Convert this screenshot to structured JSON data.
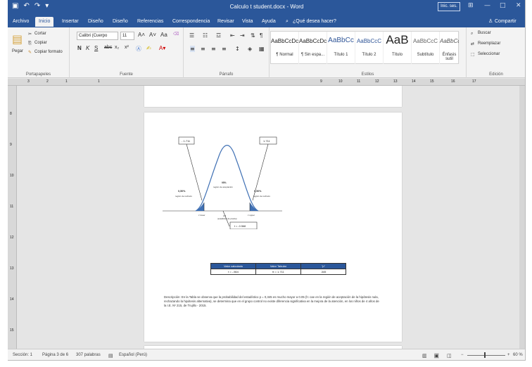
{
  "app": {
    "title": "Calculo t student.docx  -  Word",
    "signin": "Inic. ses.",
    "controls": [
      "⊞",
      "—",
      "□",
      "✕"
    ]
  },
  "quick_access": {
    "save_icon": "save-icon",
    "undo_icon": "undo-icon",
    "redo_icon": "redo-icon"
  },
  "tabs": [
    "Archivo",
    "Inicio",
    "Insertar",
    "Diseño",
    "Diseño",
    "Referencias",
    "Correspondencia",
    "Revisar",
    "Vista",
    "Ayuda"
  ],
  "tell_me": "¿Qué desea hacer?",
  "share": "Compartir",
  "clipboard": {
    "paste": "Pegar",
    "cut": "Cortar",
    "copy": "Copiar",
    "format": "Copiar formato",
    "label": "Portapapeles"
  },
  "font": {
    "family": "Calibri (Cuerpo",
    "size": "11",
    "label": "Fuente"
  },
  "paragraph": {
    "label": "Párrafo"
  },
  "styles": {
    "label": "Estilos",
    "items": [
      {
        "sample": "AaBbCcDc",
        "name": "¶ Normal"
      },
      {
        "sample": "AaBbCcDc",
        "name": "¶ Sin espa..."
      },
      {
        "sample": "AaBbCc",
        "name": "Título 1"
      },
      {
        "sample": "AaBbCcC",
        "name": "Título 2"
      },
      {
        "sample": "AaB",
        "name": "Título"
      },
      {
        "sample": "AaBbCcC",
        "name": "Subtítulo"
      },
      {
        "sample": "AaBbCcDc",
        "name": "Énfasis sutil"
      }
    ]
  },
  "editing": {
    "find": "Buscar",
    "replace": "Reemplazar",
    "select": "Seleccionar",
    "label": "Edición"
  },
  "ruler": {
    "labels": [
      "3",
      "2",
      "1",
      "1",
      "9",
      "10",
      "11",
      "12",
      "13",
      "14",
      "15",
      "16",
      "17"
    ]
  },
  "vruler_labels": [
    "8",
    "9",
    "10",
    "11",
    "12",
    "13",
    "14",
    "15"
  ],
  "figure": {
    "left_box": "- 1.711",
    "right_box": "1.711",
    "left_percent": "0,50%",
    "right_percent": "0,50%",
    "left_region": "región de rechazo",
    "right_region": "región de rechazo",
    "center_percent": "95%",
    "center_region": "región de aceptación",
    "lower": "z lower",
    "center": "1/2",
    "center_sub": "(estadístico de prueba)",
    "upper": "z upper",
    "t_value": "t = -0.568"
  },
  "table": {
    "headers": [
      "Valor calculado",
      "Valor Tabular",
      "\"p\""
    ],
    "row": [
      "t = -.564",
      "tt = 1.711",
      ".345"
    ]
  },
  "description": "Descripción: En la Tabla se observa que la probabilidad del estadístico p = 0,345 es mucho mayor a 0.05 (h: cae en la región de aceptación de la hipótesis nula, rechazando la hipótesis alternativa), se determina que en el grupo control no existe diferencia significativa en la mejora de la atención, en los niños de 4 años de la I.E. Nº 215, de Trujillo - 2015.",
  "status": {
    "section": "Sección: 1",
    "page": "Página 3 de 6",
    "words": "307 palabras",
    "language": "Español (Perú)",
    "zoom": "60 %"
  }
}
